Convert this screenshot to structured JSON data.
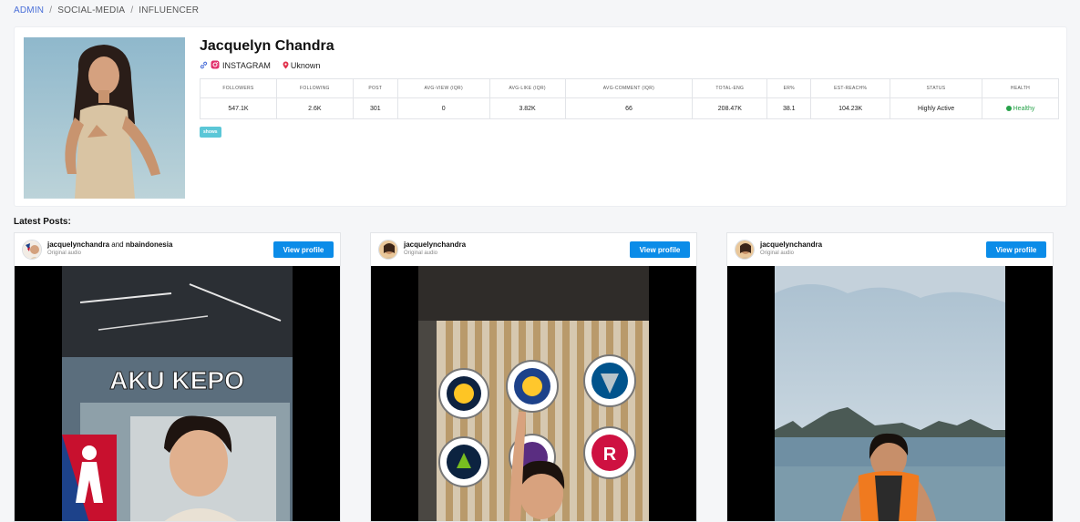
{
  "breadcrumb": {
    "items": [
      "ADMIN",
      "SOCIAL-MEDIA",
      "INFLUENCER"
    ],
    "separator": "/"
  },
  "profile": {
    "name": "Jacquelyn Chandra",
    "platform": "INSTAGRAM",
    "location": "Uknown",
    "tag": "shows",
    "stats": {
      "headers": [
        "FOLLOWERS",
        "FOLLOWING",
        "POST",
        "AVG-VIEW (IQR)",
        "AVG-LIKE (IQR)",
        "AVG-COMMENT (IQR)",
        "TOTAL-ENG",
        "ER%",
        "EST-REACH%",
        "STATUS",
        "HEALTH"
      ],
      "values": [
        "547.1K",
        "2.6K",
        "301",
        "0",
        "3.82K",
        "66",
        "208.47K",
        "38.1",
        "104.23K",
        "Highly Active",
        "Healthy"
      ]
    }
  },
  "latest_posts": {
    "title": "Latest Posts:",
    "posts": [
      {
        "user": "jacquelynchandra",
        "joiner": "and",
        "coauthor": "nbaindonesia",
        "subtitle": "Original audio",
        "button": "View profile",
        "overlay_text": "AKU KEPO"
      },
      {
        "user": "jacquelynchandra",
        "subtitle": "Original audio",
        "button": "View profile"
      },
      {
        "user": "jacquelynchandra",
        "subtitle": "Original audio",
        "button": "View profile"
      }
    ]
  },
  "colors": {
    "accent": "#0b8ce8",
    "breadcrumb_active": "#4a6fd8",
    "healthy": "#27a24a",
    "tag": "#5bc7d7"
  }
}
